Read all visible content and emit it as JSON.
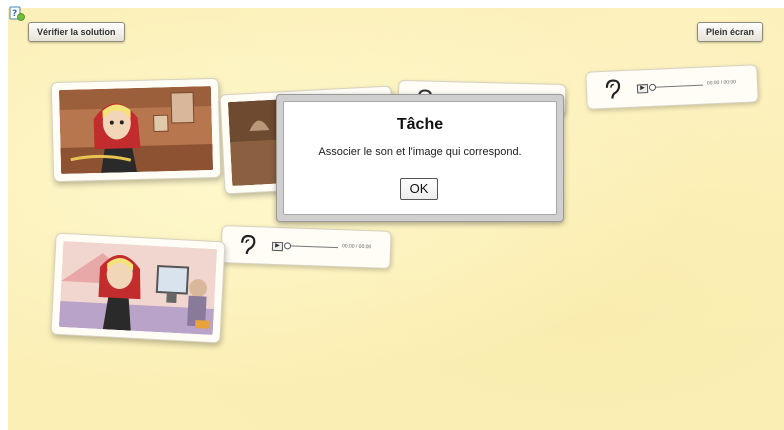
{
  "toolbar": {
    "check_label": "Vérifier la solution",
    "fullscreen_label": "Plein écran"
  },
  "audio_players": [
    {
      "time": "00:00 / 00:00"
    },
    {
      "time": "00:00 / 00:00"
    }
  ],
  "dialog": {
    "title": "Tâche",
    "message": "Associer le son et l'image qui correspond.",
    "ok_label": "OK"
  }
}
